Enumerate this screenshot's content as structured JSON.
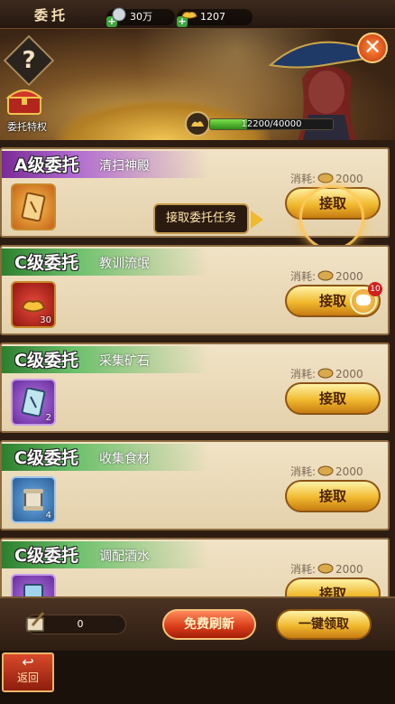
{
  "header": {
    "title": "委托",
    "silver": "30万",
    "gold": "1207"
  },
  "banner": {
    "help": "?",
    "privilege_label": "委托特权",
    "close": "✕",
    "progress_text": "12200/40000",
    "progress_fraction": 0.305
  },
  "tasks": [
    {
      "grade": "A级委托",
      "name": "清扫神殿",
      "cost_label": "消耗:",
      "cost": "2000",
      "button": "接取",
      "count": ""
    },
    {
      "grade": "C级委托",
      "name": "教训流氓",
      "cost_label": "消耗:",
      "cost": "2000",
      "button": "接取",
      "count": "30"
    },
    {
      "grade": "C级委托",
      "name": "采集矿石",
      "cost_label": "消耗:",
      "cost": "2000",
      "button": "接取",
      "count": "2"
    },
    {
      "grade": "C级委托",
      "name": "收集食材",
      "cost_label": "消耗:",
      "cost": "2000",
      "button": "接取",
      "count": "4"
    },
    {
      "grade": "C级委托",
      "name": "调配酒水",
      "cost_label": "消耗:",
      "cost": "2000",
      "button": "接取",
      "count": ""
    }
  ],
  "guide": {
    "text": "接取委托任务"
  },
  "chat": {
    "badge": "10"
  },
  "bottom": {
    "scroll_count": "0",
    "refresh": "免费刷新",
    "claim_all": "一键领取"
  },
  "footer": {
    "back": "返回"
  }
}
